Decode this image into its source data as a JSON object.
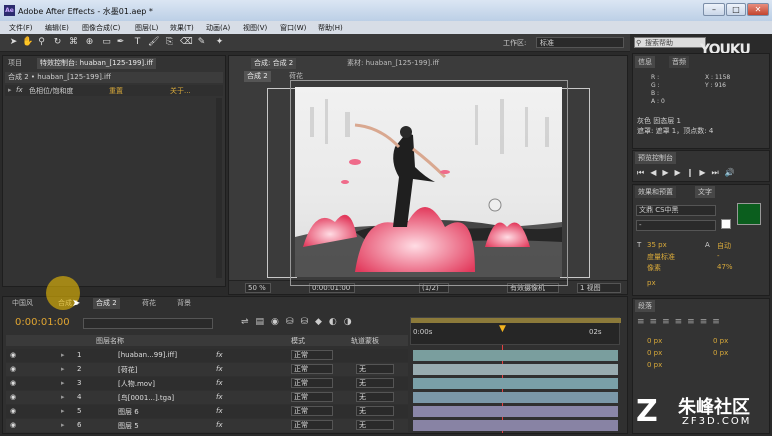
{
  "window": {
    "title": "Adobe After Effects - 水墨01.aep *",
    "app_icon": "Ae",
    "min": "–",
    "max": "□",
    "close": "✕"
  },
  "menu": [
    "文件(F)",
    "编辑(E)",
    "图像合成(C)",
    "图层(L)",
    "效果(T)",
    "动画(A)",
    "视图(V)",
    "窗口(W)",
    "帮助(H)"
  ],
  "toolbar": {
    "workspace_label": "工作区:",
    "workspace_value": "标准",
    "search_placeholder": "搜索帮助"
  },
  "watermarks": {
    "youku_brand": "YOUKU",
    "youku_cn": "优酷",
    "zf3d_cn": "朱峰社区",
    "zf3d_site": "ZF3D.COM"
  },
  "left_panel": {
    "tabs": [
      "项目",
      "特效控制台: huaban_[125-199].iff"
    ],
    "header": "合成 2 • huaban_[125-199].iff",
    "effect_fx": "fx",
    "effect_name": "色相位/饱和度",
    "reset": "重置",
    "about": "关于..."
  },
  "comp_panel": {
    "tab": "合成: 合成 2",
    "nav": [
      "合成 2",
      "荷花"
    ],
    "footage_tab": "素材: huaban_[125-199].iff",
    "zoom": "50 %",
    "time": "0:00:01:00",
    "resolution": "(1/2)",
    "camera": "有效摄像机",
    "views": "1 视图"
  },
  "info_panel": {
    "tabs": [
      "信息",
      "音频"
    ],
    "r": "R :",
    "g": "G :",
    "b": "B :",
    "a": "A : 0",
    "x": "X : 1158",
    "y": "Y : 916",
    "line1": "灰色 固态层 1",
    "line2": "遮罩: 遮罩 1，顶点数: 4"
  },
  "preview_panel": {
    "tab": "预览控制台"
  },
  "char_panel": {
    "tabs": [
      "效果和预置",
      "文字"
    ],
    "font": "文鼎 CS中黑",
    "style": "-",
    "size": "35 px",
    "leading": "自动",
    "kerning_label": "度量标准",
    "tracking": "-",
    "stroke": "像素",
    "scale": "47%",
    "baseline": "px"
  },
  "para_panel": {
    "tab": "段落",
    "indent_left": "0 px",
    "indent_right": "0 px",
    "space_before": "0 px",
    "space_after": "0 px",
    "first_indent": "0 px"
  },
  "timeline": {
    "tabs": [
      "中国风",
      "合成 1",
      "合成 2",
      "荷花",
      "背景"
    ],
    "current_time": "0:00:01:00",
    "col_name": "图层名称",
    "col_mode": "模式",
    "col_trkmat": "轨道蒙板",
    "ruler_start": "0:00s",
    "ruler_end": "02s"
  },
  "layers": [
    {
      "num": "1",
      "name": "[huaban...99].iff]",
      "mode": "正常",
      "trk": "",
      "bar_color": "#7a9e9e"
    },
    {
      "num": "2",
      "name": "[荷花]",
      "mode": "正常",
      "trk": "无",
      "bar_color": "#98acb0"
    },
    {
      "num": "3",
      "name": "[人物.mov]",
      "mode": "正常",
      "trk": "无",
      "bar_color": "#7aa0a8"
    },
    {
      "num": "4",
      "name": "[鸟[0001...].tga]",
      "mode": "正常",
      "trk": "无",
      "bar_color": "#7b98a8"
    },
    {
      "num": "5",
      "name": "图层 6",
      "mode": "正常",
      "trk": "无",
      "bar_color": "#8a86a8"
    },
    {
      "num": "6",
      "name": "图层 5",
      "mode": "正常",
      "trk": "无",
      "bar_color": "#8883a4"
    }
  ]
}
